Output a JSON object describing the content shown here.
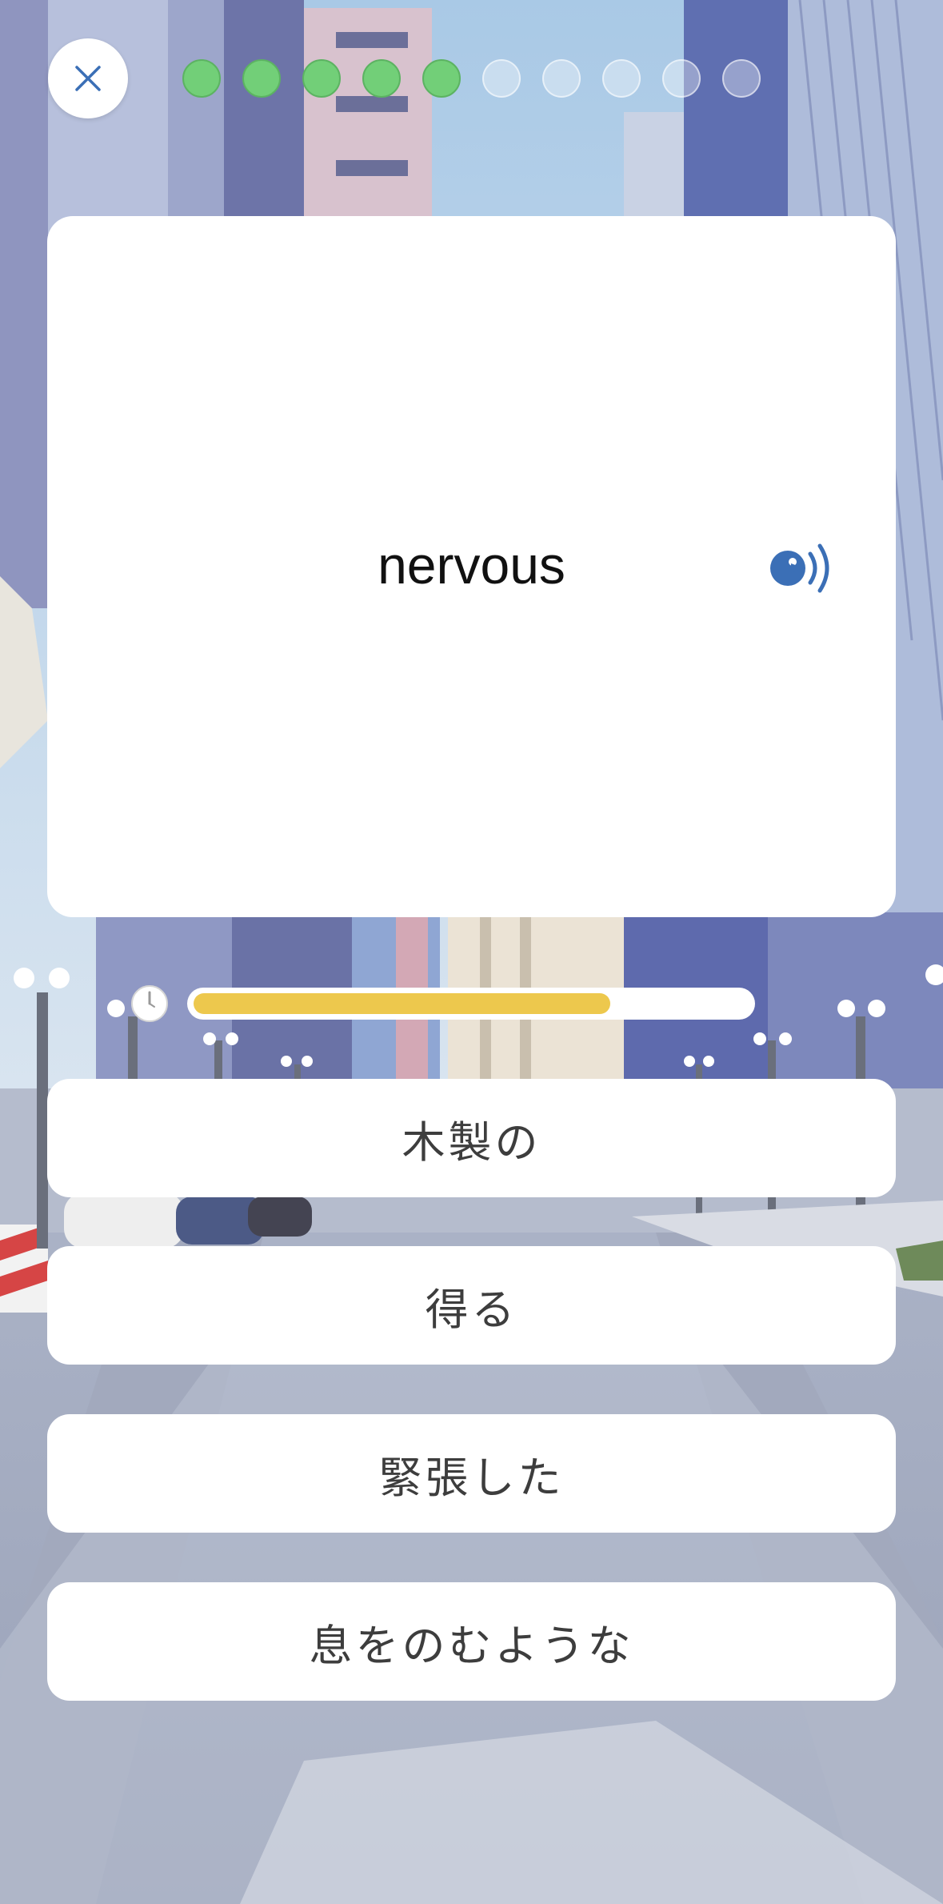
{
  "header": {
    "close_icon": "close-icon",
    "progress": {
      "total": 10,
      "completed": 5
    },
    "colors": {
      "done": "#72cf78",
      "todo": "rgba(255,255,255,0.35)"
    }
  },
  "card": {
    "word": "nervous",
    "audio_icon": "speaker-icon",
    "audio_color": "#3b6fb6"
  },
  "timer": {
    "icon": "clock-icon",
    "remaining_fraction": 0.75,
    "color": "#edc84d"
  },
  "answers": [
    {
      "label": "木製の"
    },
    {
      "label": "得る"
    },
    {
      "label": "緊張した"
    },
    {
      "label": "息をのむような"
    }
  ]
}
